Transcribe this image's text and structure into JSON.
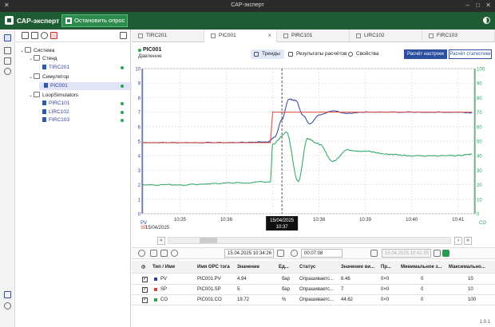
{
  "window": {
    "title": "САР-эксперт"
  },
  "app": {
    "name": "САР-эксперт",
    "stop_button": "Остановить опрос"
  },
  "tree": {
    "nodes": [
      {
        "label": "Система",
        "level": 0,
        "type": "folder"
      },
      {
        "label": "Стенд",
        "level": 1,
        "type": "folder"
      },
      {
        "label": "TIRC201",
        "level": 2,
        "type": "leaf",
        "status": "ok"
      },
      {
        "label": "Симулятор",
        "level": 1,
        "type": "folder"
      },
      {
        "label": "PIC001",
        "level": 2,
        "type": "leaf",
        "status": "ok",
        "selected": true
      },
      {
        "label": "LoopSimulators",
        "level": 1,
        "type": "folder"
      },
      {
        "label": "PIRC101",
        "level": 2,
        "type": "leaf",
        "status": "ok"
      },
      {
        "label": "LIRC102",
        "level": 2,
        "type": "leaf",
        "status": "ok"
      },
      {
        "label": "FIRC103",
        "level": 2,
        "type": "leaf",
        "status": "ok"
      }
    ]
  },
  "tabs": [
    {
      "label": "TIRC201"
    },
    {
      "label": "PIC001",
      "active": true
    },
    {
      "label": "PIRC101"
    },
    {
      "label": "LIRC102"
    },
    {
      "label": "FIRC103"
    }
  ],
  "header": {
    "tag": "PIC001",
    "description": "Давление",
    "views": [
      "Тренды",
      "Результаты расчётов",
      "Свойства"
    ],
    "calc_settings": "Расчёт настроек",
    "calc_stats": "Расчёт статистики"
  },
  "chart_data": {
    "type": "line",
    "x_ticks": [
      "10:35",
      "10:36",
      "10:37",
      "10:38",
      "10:39",
      "10:40",
      "10:41"
    ],
    "date_label": "15/04/2025",
    "cursor": {
      "date": "15/04/2025",
      "time": "10:37"
    },
    "left_axis": {
      "ticks": [
        "0",
        "1",
        "2",
        "3",
        "4",
        "5",
        "6",
        "7",
        "8",
        "9",
        "10"
      ],
      "range": [
        0,
        10
      ]
    },
    "right_axis": {
      "ticks": [
        "0",
        "10",
        "20",
        "30",
        "40",
        "50",
        "60",
        "70",
        "80",
        "90",
        "100"
      ],
      "range": [
        0,
        100
      ]
    },
    "left_labels": [
      "PV",
      "SP"
    ],
    "right_label": "CO",
    "grid": true,
    "series": [
      {
        "name": "PV",
        "color": "#2f3f9a",
        "axis": "left",
        "x": [
          "10:34.2",
          "10:35",
          "10:36",
          "10:36.9",
          "10:37.05",
          "10:37.2",
          "10:37.35",
          "10:37.5",
          "10:37.65",
          "10:37.8",
          "10:38",
          "10:38.3",
          "10:38.6",
          "10:39",
          "10:40",
          "10:41",
          "10:41.3"
        ],
        "y": [
          4.9,
          4.9,
          4.9,
          4.95,
          5.3,
          6.5,
          7.9,
          7.8,
          6.8,
          6.2,
          6.8,
          7.1,
          6.9,
          7.0,
          7.0,
          7.0,
          6.95
        ]
      },
      {
        "name": "SP",
        "color": "#d8473b",
        "axis": "left",
        "x": [
          "10:34.2",
          "10:36.95",
          "10:37.0",
          "10:41.3"
        ],
        "y": [
          4.9,
          4.9,
          7.0,
          7.0
        ]
      },
      {
        "name": "CO",
        "color": "#22a55a",
        "axis": "right",
        "x": [
          "10:34.2",
          "10:35",
          "10:36",
          "10:36.95",
          "10:37.0",
          "10:37.3",
          "10:37.55",
          "10:37.75",
          "10:38",
          "10:38.3",
          "10:38.6",
          "10:39",
          "10:39.5",
          "10:40",
          "10:41",
          "10:41.3"
        ],
        "y": [
          20,
          20,
          21,
          22,
          48,
          56,
          22,
          52,
          48,
          36,
          44,
          43,
          41,
          40,
          40,
          41
        ]
      }
    ]
  },
  "nav": {
    "scroll_thumb": "",
    "prev": "‹",
    "next": "›",
    "first": "«",
    "last": "»"
  },
  "time_toolbar": {
    "start": "15.04.2025 10:34:26",
    "duration": "00:07:08",
    "end": "15.04.2025 10:41:35"
  },
  "table": {
    "headers": [
      "Тип / Имя",
      "Имя OPC тэга",
      "Значение",
      "Ед...",
      "Статус",
      "Значение ви...",
      "Пр...",
      "Минимальное з...",
      "Максимально..."
    ],
    "rows": [
      {
        "checked": "✓",
        "color": "#2f3f9a",
        "type": "PV",
        "opc": "PIC001.PV",
        "value": "4.94",
        "unit": "бар",
        "status": "Опрашиваетс...",
        "vis": "6.46",
        "pr": "0×0",
        "min": "0",
        "max": "10"
      },
      {
        "checked": "✓",
        "color": "#d8473b",
        "type": "SP",
        "opc": "PIC001.SP",
        "value": "5",
        "unit": "бар",
        "status": "Опрашиваетс...",
        "vis": "7",
        "pr": "0×0",
        "min": "0",
        "max": "10"
      },
      {
        "checked": "✓",
        "color": "#22a55a",
        "type": "CO",
        "opc": "PIC001.CO",
        "value": "19.72",
        "unit": "%",
        "status": "Опрашиваетс...",
        "vis": "44.62",
        "pr": "0×0",
        "min": "0",
        "max": "100"
      }
    ]
  },
  "status": {
    "version": "1.0.1"
  }
}
